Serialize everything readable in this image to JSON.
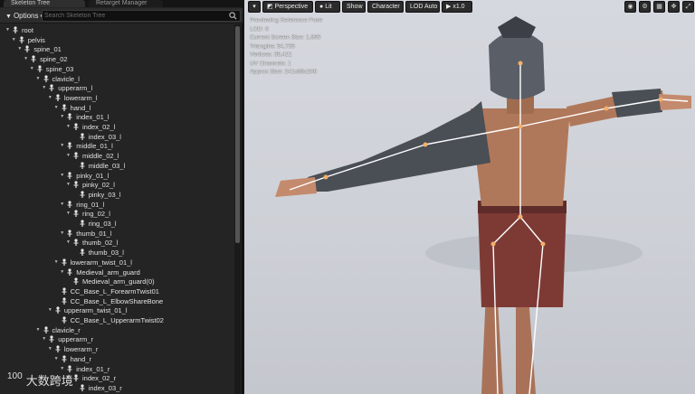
{
  "left_panel": {
    "tabs": [
      {
        "label": "Skeleton Tree"
      },
      {
        "label": "Retarget Manager"
      }
    ],
    "options_label": "Options",
    "search_placeholder": "Search Skeleton Tree",
    "tree": [
      {
        "label": "root",
        "depth": 0,
        "expanded": true
      },
      {
        "label": "pelvis",
        "depth": 1,
        "expanded": true
      },
      {
        "label": "spine_01",
        "depth": 2,
        "expanded": true
      },
      {
        "label": "spine_02",
        "depth": 3,
        "expanded": true
      },
      {
        "label": "spine_03",
        "depth": 4,
        "expanded": true
      },
      {
        "label": "clavicle_l",
        "depth": 5,
        "expanded": true
      },
      {
        "label": "upperarm_l",
        "depth": 6,
        "expanded": true
      },
      {
        "label": "lowerarm_l",
        "depth": 7,
        "expanded": true
      },
      {
        "label": "hand_l",
        "depth": 8,
        "expanded": true
      },
      {
        "label": "index_01_l",
        "depth": 9,
        "expanded": true
      },
      {
        "label": "index_02_l",
        "depth": 10,
        "expanded": true
      },
      {
        "label": "index_03_l",
        "depth": 11,
        "expanded": false
      },
      {
        "label": "middle_01_l",
        "depth": 9,
        "expanded": true
      },
      {
        "label": "middle_02_l",
        "depth": 10,
        "expanded": true
      },
      {
        "label": "middle_03_l",
        "depth": 11,
        "expanded": false
      },
      {
        "label": "pinky_01_l",
        "depth": 9,
        "expanded": true
      },
      {
        "label": "pinky_02_l",
        "depth": 10,
        "expanded": true
      },
      {
        "label": "pinky_03_l",
        "depth": 11,
        "expanded": false
      },
      {
        "label": "ring_01_l",
        "depth": 9,
        "expanded": true
      },
      {
        "label": "ring_02_l",
        "depth": 10,
        "expanded": true
      },
      {
        "label": "ring_03_l",
        "depth": 11,
        "expanded": false
      },
      {
        "label": "thumb_01_l",
        "depth": 9,
        "expanded": true
      },
      {
        "label": "thumb_02_l",
        "depth": 10,
        "expanded": true
      },
      {
        "label": "thumb_03_l",
        "depth": 11,
        "expanded": false
      },
      {
        "label": "lowerarm_twist_01_l",
        "depth": 8,
        "expanded": true
      },
      {
        "label": "Medieval_arm_guard",
        "depth": 9,
        "expanded": true
      },
      {
        "label": "Medieval_arm_guard(0)",
        "depth": 10,
        "expanded": false
      },
      {
        "label": "CC_Base_L_ForearmTwist01",
        "depth": 8,
        "expanded": false
      },
      {
        "label": "CC_Base_L_ElbowShareBone",
        "depth": 8,
        "expanded": false
      },
      {
        "label": "upperarm_twist_01_l",
        "depth": 7,
        "expanded": true
      },
      {
        "label": "CC_Base_L_UpperarmTwist02",
        "depth": 8,
        "expanded": false
      },
      {
        "label": "clavicle_r",
        "depth": 5,
        "expanded": true
      },
      {
        "label": "upperarm_r",
        "depth": 6,
        "expanded": true
      },
      {
        "label": "lowerarm_r",
        "depth": 7,
        "expanded": true
      },
      {
        "label": "hand_r",
        "depth": 8,
        "expanded": true
      },
      {
        "label": "index_01_r",
        "depth": 9,
        "expanded": true
      },
      {
        "label": "index_02_r",
        "depth": 10,
        "expanded": true
      },
      {
        "label": "index_03_r",
        "depth": 11,
        "expanded": false
      }
    ]
  },
  "viewport": {
    "toolbar": {
      "menu_label": "▾",
      "perspective_label": "Perspective",
      "lit_label": "Lit",
      "show_label": "Show",
      "character_label": "Character",
      "lod_label": "LOD Auto",
      "speed_label": "x1.0"
    },
    "info_lines": [
      "Previewing Reference Pose",
      "LOD: 0",
      "Current Screen Size: 1.895",
      "Triangles: 54,735",
      "Vertices: 35,421",
      "UV Channels: 1",
      "Approx Size: 241x88x206"
    ],
    "icons": [
      "camera-icon",
      "gear-icon",
      "grid-icon",
      "transform-icon",
      "maximize-icon"
    ],
    "colors": {
      "background": "#cdd0d6",
      "skin": "#b0785a",
      "armor": "#4a4e55",
      "cloth": "#7d3a35",
      "bones": "#ffffff",
      "joints": "#f2b06a"
    }
  },
  "watermark": {
    "logo": "100",
    "text": "大数跨境"
  }
}
